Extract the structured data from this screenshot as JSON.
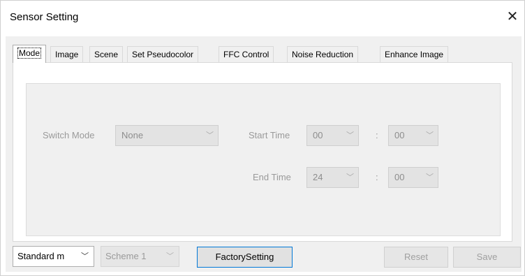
{
  "window": {
    "title": "Sensor Setting",
    "close_glyph": "✕"
  },
  "tabs": [
    {
      "label": "Mode",
      "active": true
    },
    {
      "label": "Image",
      "active": false
    },
    {
      "label": "Scene",
      "active": false
    },
    {
      "label": "Set Pseudocolor",
      "active": false
    },
    {
      "label": "FFC Control",
      "active": false
    },
    {
      "label": "Noise Reduction",
      "active": false
    },
    {
      "label": "Enhance Image",
      "active": false
    }
  ],
  "mode_panel": {
    "switch_mode_label": "Switch Mode",
    "switch_mode_value": "None",
    "start_time_label": "Start Time",
    "start_hour": "00",
    "start_minute": "00",
    "end_time_label": "End Time",
    "end_hour": "24",
    "end_minute": "00",
    "time_separator": ":"
  },
  "bottom": {
    "standard_combo": "Standard m",
    "scheme_combo": "Scheme 1",
    "factory_button": "FactorySetting",
    "reset_button": "Reset",
    "save_button": "Save"
  },
  "icons": {
    "dropdown": "chevron-down-icon",
    "close": "close-icon"
  },
  "colors": {
    "focus_border": "#0078d7",
    "disabled_text": "#9a9a9a"
  }
}
